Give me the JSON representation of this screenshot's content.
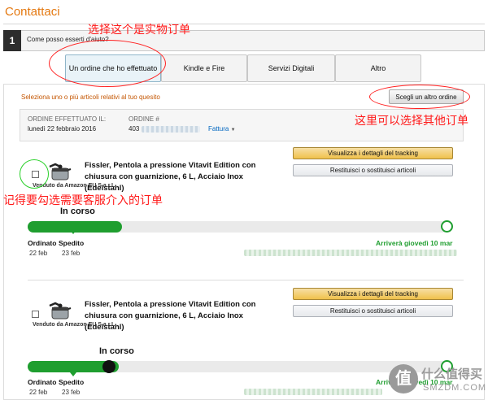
{
  "page_title": "Contattaci",
  "step": {
    "number": "1",
    "question": "Come posso esserti d'aiuto?"
  },
  "tabs": [
    {
      "label": "Un ordine che ho effettuato",
      "selected": true
    },
    {
      "label": "Kindle e Fire",
      "selected": false
    },
    {
      "label": "Servizi Digitali",
      "selected": false
    },
    {
      "label": "Altro",
      "selected": false
    }
  ],
  "select_hint": "Seleziona uno o più articoli relativi al tuo quesito",
  "choose_other_button": "Scegli un altro ordine",
  "order": {
    "placed_label": "ORDINE EFFETTUATO IL:",
    "placed_date": "lunedì 22 febbraio 2016",
    "number_label": "ORDINE #",
    "number_prefix": "403",
    "invoice_link": "Fattura"
  },
  "items": [
    {
      "product_name": "Fissler, Pentola a pressione Vitavit Edition con chiusura con guarnizione, 6 L, Acciaio Inox (Edelstahl)",
      "seller": "Venduto da Amazon EU S.a.r.L.",
      "tracking_button": "Visualizza i dettagli del tracking",
      "return_button": "Restituisci o sostituisci articoli",
      "status": "In corso",
      "steps": [
        {
          "label": "Ordinato",
          "date": "22 feb"
        },
        {
          "label": "Spedito",
          "date": "23 feb"
        }
      ],
      "arrival": "Arriverà giovedì 10 mar",
      "progress": 0.33
    },
    {
      "product_name": "Fissler, Pentola a pressione Vitavit Edition con chiusura con guarnizione, 6 L, Acciaio Inox (Edelstahl)",
      "seller": "Venduto da Amazon EU S.a.r.L.",
      "tracking_button": "Visualizza i dettagli del tracking",
      "return_button": "Restituisci o sostituisci articoli",
      "status": "In corso",
      "steps": [
        {
          "label": "Ordinato",
          "date": "22 feb"
        },
        {
          "label": "Spedito",
          "date": "23 feb"
        }
      ],
      "arrival": "Arriverà giovedì 10 mar",
      "progress": 0.33
    }
  ],
  "annotations": {
    "select_physical_order": "选择这个是实物订单",
    "choose_other_order": "这里可以选择其他订单",
    "check_item": "记得要勾选需要客服介入的订单"
  },
  "watermark": {
    "badge": "值",
    "line1": "什么值得买",
    "line2": "SMZDM.COM"
  }
}
